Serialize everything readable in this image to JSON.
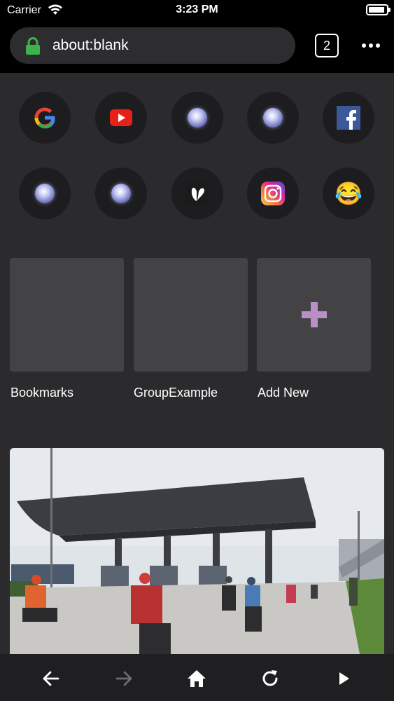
{
  "status_bar": {
    "carrier": "Carrier",
    "time": "3:23 PM"
  },
  "url_bar": {
    "url": "about:blank",
    "tab_count": "2"
  },
  "speed_dial": [
    {
      "name": "google-icon"
    },
    {
      "name": "youtube-icon"
    },
    {
      "name": "globe-icon"
    },
    {
      "name": "globe-icon"
    },
    {
      "name": "facebook-icon"
    },
    {
      "name": "globe-icon"
    },
    {
      "name": "globe-icon"
    },
    {
      "name": "butterfly-icon"
    },
    {
      "name": "instagram-icon"
    },
    {
      "name": "joy-emoji-icon",
      "glyph": "😂"
    }
  ],
  "folders": [
    {
      "label": "Bookmarks"
    },
    {
      "label": "GroupExample"
    },
    {
      "label": "Add New"
    }
  ],
  "toolbar": [
    "back-icon",
    "forward-icon",
    "home-icon",
    "reload-icon",
    "play-icon"
  ],
  "colors": {
    "lock": "#3db24a",
    "plus": "#b88fc6",
    "forward_disabled": "#6d6d70"
  }
}
